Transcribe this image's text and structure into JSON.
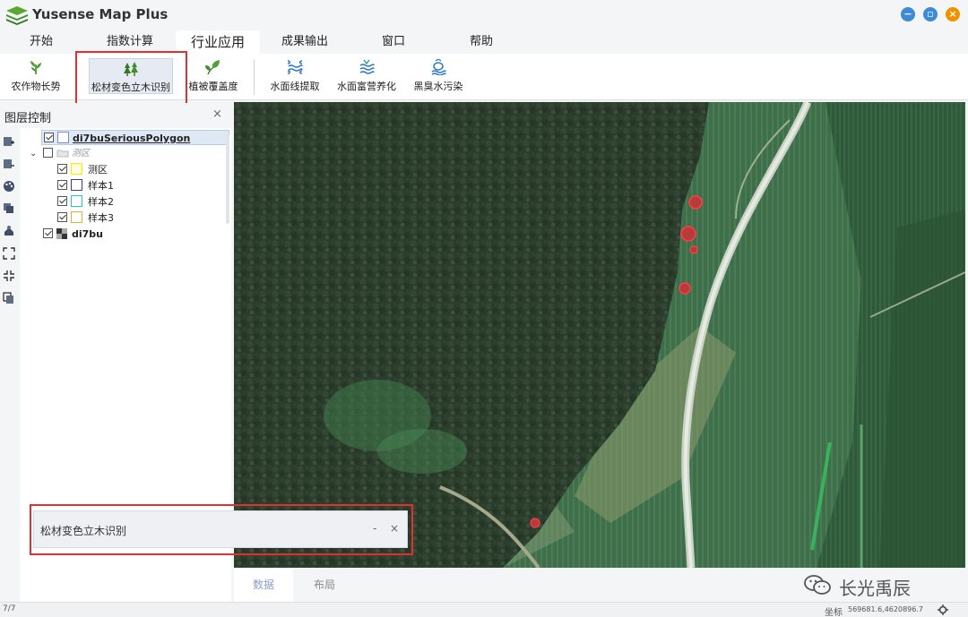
{
  "app": {
    "title": "Yusense Map Plus"
  },
  "menu": {
    "tabs": [
      {
        "label": "开始"
      },
      {
        "label": "指数计算"
      },
      {
        "label": "行业应用"
      },
      {
        "label": "成果输出"
      },
      {
        "label": "窗口"
      },
      {
        "label": "帮助"
      }
    ]
  },
  "ribbon": {
    "tools": [
      {
        "label": "农作物长势",
        "icon": "crop-growth-icon"
      },
      {
        "label": "松材变色立木识别",
        "icon": "pine-tree-icon"
      },
      {
        "label": "植被覆盖度",
        "icon": "vegetation-leaf-icon"
      },
      {
        "label": "水面线提取",
        "icon": "waterline-icon"
      },
      {
        "label": "水面富营养化",
        "icon": "eutrophication-icon"
      },
      {
        "label": "黑臭水污染",
        "icon": "water-pollution-icon"
      }
    ]
  },
  "layer_panel": {
    "title": "图层控制",
    "close": "×",
    "layers": [
      {
        "label": "di7buSeriousPolygon",
        "checked": true,
        "swatch": "#7c8cc8"
      },
      {
        "label": "测区",
        "checked": false
      },
      {
        "label": "测区",
        "checked": true,
        "swatch": "#f5f000"
      },
      {
        "label": "样本1",
        "checked": true,
        "swatch": "#3a3aa0"
      },
      {
        "label": "样本2",
        "checked": true,
        "swatch": "#20c8d8"
      },
      {
        "label": "样本3",
        "checked": true,
        "swatch": "#e0b040"
      },
      {
        "label": "di7bu",
        "checked": true
      }
    ]
  },
  "popup": {
    "title": "松材变色立木识别",
    "minimize": "-",
    "close": "×"
  },
  "bottom_tabs": [
    {
      "label": "数据"
    },
    {
      "label": "布局"
    }
  ],
  "watermark": {
    "text": "长光禹辰"
  },
  "status": {
    "page": "7/7",
    "coord_label": "坐标",
    "coord_value": "569681.6,4620896.7"
  },
  "colors": {
    "accent_red": "#e03030",
    "window_blue": "#3d8ad8",
    "window_orange": "#f29100"
  }
}
